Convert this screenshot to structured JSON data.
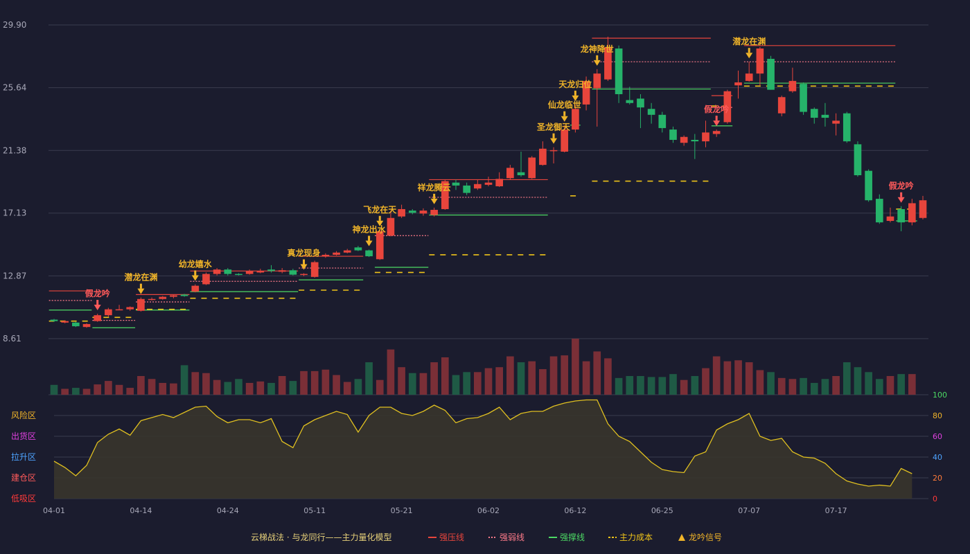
{
  "chart_data": {
    "type": "candlestick",
    "x_tick_labels": [
      "04-01",
      "04-14",
      "04-24",
      "05-11",
      "05-21",
      "06-02",
      "06-12",
      "06-25",
      "07-07",
      "07-17"
    ],
    "x_tick_indices": [
      0,
      8,
      16,
      24,
      32,
      40,
      48,
      56,
      64,
      72
    ],
    "price_axis": {
      "ticks": [
        "29.90",
        "25.64",
        "21.38",
        "17.13",
        "12.87",
        "8.61"
      ],
      "min": 8.61,
      "max": 29.9
    },
    "candles": [
      [
        9.9,
        9.8,
        9.95,
        9.75
      ],
      [
        9.7,
        9.8,
        9.85,
        9.65
      ],
      [
        9.7,
        9.45,
        9.75,
        9.4
      ],
      [
        9.4,
        9.6,
        9.65,
        9.35
      ],
      [
        9.8,
        10.2,
        10.3,
        9.75
      ],
      [
        10.2,
        10.6,
        10.7,
        10.1
      ],
      [
        10.6,
        10.6,
        10.9,
        10.55
      ],
      [
        10.6,
        10.75,
        10.8,
        10.5
      ],
      [
        10.5,
        11.3,
        11.4,
        10.45
      ],
      [
        11.3,
        11.3,
        11.4,
        11.2
      ],
      [
        11.3,
        11.45,
        11.5,
        11.25
      ],
      [
        11.45,
        11.55,
        11.6,
        11.35
      ],
      [
        11.6,
        11.5,
        11.65,
        11.45
      ],
      [
        11.8,
        12.2,
        12.3,
        11.75
      ],
      [
        12.3,
        13.0,
        13.1,
        12.25
      ],
      [
        13.0,
        13.3,
        13.4,
        12.9
      ],
      [
        13.3,
        13.0,
        13.4,
        12.9
      ],
      [
        13.0,
        12.95,
        13.05,
        12.9
      ],
      [
        13.0,
        13.2,
        13.3,
        12.95
      ],
      [
        13.1,
        13.2,
        13.35,
        13.05
      ],
      [
        13.3,
        13.2,
        13.6,
        13.1
      ],
      [
        13.15,
        13.25,
        13.4,
        13.05
      ],
      [
        13.25,
        12.95,
        13.35,
        12.9
      ],
      [
        12.95,
        13.0,
        13.05,
        12.85
      ],
      [
        12.8,
        13.8,
        13.9,
        12.75
      ],
      [
        14.2,
        14.3,
        14.4,
        14.1
      ],
      [
        14.3,
        14.45,
        14.55,
        14.25
      ],
      [
        14.45,
        14.6,
        14.7,
        14.4
      ],
      [
        14.8,
        14.6,
        14.9,
        14.55
      ],
      [
        14.6,
        14.2,
        14.65,
        14.15
      ],
      [
        14.0,
        15.9,
        16.0,
        13.95
      ],
      [
        15.6,
        16.8,
        17.3,
        15.55
      ],
      [
        16.9,
        17.4,
        17.7,
        16.8
      ],
      [
        17.3,
        17.15,
        17.4,
        17.05
      ],
      [
        17.1,
        17.3,
        17.45,
        16.95
      ],
      [
        17.0,
        17.35,
        17.5,
        16.9
      ],
      [
        17.4,
        19.3,
        19.4,
        17.35
      ],
      [
        19.2,
        19.0,
        19.4,
        18.7
      ],
      [
        19.0,
        18.5,
        19.2,
        18.35
      ],
      [
        18.8,
        19.1,
        19.4,
        18.7
      ],
      [
        19.05,
        19.2,
        19.6,
        18.95
      ],
      [
        18.95,
        19.45,
        19.9,
        18.9
      ],
      [
        19.5,
        20.2,
        20.4,
        19.4
      ],
      [
        19.9,
        19.7,
        21.3,
        19.6
      ],
      [
        19.5,
        20.9,
        21.0,
        19.45
      ],
      [
        20.4,
        21.5,
        22.0,
        20.35
      ],
      [
        21.4,
        21.4,
        21.6,
        20.5
      ],
      [
        21.3,
        22.8,
        23.1,
        21.25
      ],
      [
        22.8,
        24.2,
        24.5,
        22.6
      ],
      [
        24.5,
        26.1,
        26.4,
        24.1
      ],
      [
        25.6,
        26.6,
        26.9,
        23.0
      ],
      [
        26.2,
        28.4,
        29.1,
        26.1
      ],
      [
        28.3,
        25.2,
        28.5,
        24.6
      ],
      [
        24.8,
        24.6,
        25.7,
        24.5
      ],
      [
        24.9,
        24.3,
        25.2,
        22.9
      ],
      [
        24.2,
        23.8,
        24.6,
        23.2
      ],
      [
        23.8,
        22.9,
        24.0,
        22.6
      ],
      [
        22.8,
        22.1,
        23.0,
        21.9
      ],
      [
        21.9,
        22.3,
        22.4,
        21.7
      ],
      [
        22.1,
        22.0,
        22.5,
        20.8
      ],
      [
        22.0,
        22.6,
        23.4,
        21.6
      ],
      [
        22.5,
        22.7,
        22.8,
        22.3
      ],
      [
        23.3,
        25.4,
        25.5,
        23.2
      ],
      [
        25.8,
        26.0,
        26.8,
        24.9
      ],
      [
        26.1,
        26.6,
        27.4,
        26.05
      ],
      [
        26.6,
        28.3,
        28.4,
        25.8
      ],
      [
        27.6,
        25.5,
        27.8,
        25.5
      ],
      [
        23.9,
        25.0,
        25.1,
        23.7
      ],
      [
        25.4,
        26.1,
        27.0,
        25.3
      ],
      [
        25.9,
        24.0,
        26.0,
        23.8
      ],
      [
        24.2,
        23.6,
        24.3,
        23.2
      ],
      [
        23.8,
        23.6,
        24.6,
        23.0
      ],
      [
        23.2,
        23.4,
        23.9,
        22.4
      ],
      [
        23.9,
        22.0,
        24.0,
        21.9
      ],
      [
        21.8,
        19.7,
        22.0,
        19.6
      ],
      [
        20.0,
        18.0,
        20.1,
        17.9
      ],
      [
        18.1,
        16.5,
        18.4,
        16.4
      ],
      [
        16.6,
        16.9,
        17.5,
        16.5
      ],
      [
        17.4,
        16.5,
        17.6,
        15.9
      ],
      [
        16.5,
        17.8,
        18.1,
        16.3
      ],
      [
        16.8,
        18.0,
        18.3,
        16.7
      ]
    ],
    "volume": [
      1,
      0.6,
      0.7,
      0.6,
      1.05,
      1.4,
      1.0,
      0.7,
      1.9,
      1.6,
      1.2,
      1.15,
      3.0,
      2.3,
      2.2,
      1.5,
      1.3,
      1.6,
      1.2,
      1.35,
      1.2,
      1.9,
      1.4,
      2.4,
      2.4,
      2.55,
      2.0,
      1.3,
      1.6,
      3.3,
      1.5,
      4.6,
      2.8,
      2.2,
      2.2,
      3.3,
      3.8,
      2.0,
      2.3,
      2.3,
      2.7,
      2.8,
      3.9,
      3.3,
      3.4,
      2.6,
      3.9,
      4.0,
      5.7,
      3.4,
      4.4,
      3.7,
      1.7,
      1.9,
      1.9,
      1.8,
      1.8,
      2.1,
      1.5,
      1.9,
      2.7,
      3.9,
      3.4,
      3.5,
      3.3,
      2.5,
      2.3,
      1.7,
      1.6,
      1.7,
      1.2,
      1.6,
      1.9,
      3.3,
      2.8,
      2.3,
      1.6,
      1.9,
      2.1,
      2.1
    ],
    "volume_max": 5.7,
    "oscillator": {
      "axis_ticks": [
        "100",
        "80",
        "60",
        "40",
        "20",
        "0"
      ],
      "zones": [
        "风险区",
        "出货区",
        "拉升区",
        "建仓区",
        "低吸区"
      ],
      "values": [
        36,
        30,
        22,
        32,
        54,
        62,
        67,
        61,
        75,
        78,
        81,
        78,
        83,
        88,
        89,
        79,
        73,
        76,
        76,
        73,
        77,
        55,
        49,
        70,
        76,
        80,
        84,
        81,
        64,
        80,
        88,
        88,
        82,
        80,
        84,
        90,
        85,
        73,
        77,
        78,
        82,
        88,
        76,
        82,
        84,
        84,
        89,
        92,
        94,
        95,
        95,
        72,
        60,
        55,
        45,
        35,
        28,
        26,
        25,
        41,
        45,
        66,
        72,
        76,
        82,
        60,
        56,
        58,
        45,
        40,
        39,
        34,
        24,
        17,
        14,
        12,
        13,
        12,
        29,
        24
      ]
    },
    "signals": [
      {
        "index": 4,
        "label": "假龙吟",
        "type": "fake"
      },
      {
        "index": 8,
        "label": "潜龙在渊",
        "type": "real"
      },
      {
        "index": 13,
        "label": "幼龙嬉水",
        "type": "real"
      },
      {
        "index": 23,
        "label": "真龙现身",
        "type": "real"
      },
      {
        "index": 29,
        "label": "神龙出水",
        "type": "real"
      },
      {
        "index": 30,
        "label": "飞龙在天",
        "type": "real"
      },
      {
        "index": 35,
        "label": "祥龙腾云",
        "type": "real"
      },
      {
        "index": 46,
        "label": "圣龙御天",
        "type": "real"
      },
      {
        "index": 47,
        "label": "仙龙临世",
        "type": "real"
      },
      {
        "index": 48,
        "label": "天龙归位",
        "type": "real"
      },
      {
        "index": 50,
        "label": "龙神降世",
        "type": "real"
      },
      {
        "index": 61,
        "label": "假龙吟",
        "type": "fake"
      },
      {
        "index": 64,
        "label": "潜龙在渊",
        "type": "real"
      },
      {
        "index": 78,
        "label": "假龙吟",
        "type": "fake"
      }
    ],
    "levels": [
      {
        "kind": "strong_resist",
        "from": 0,
        "to": 3,
        "price": 11.85
      },
      {
        "kind": "weak",
        "from": 0,
        "to": 3,
        "price": 11.2
      },
      {
        "kind": "strong_support",
        "from": 0,
        "to": 3,
        "price": 10.55
      },
      {
        "kind": "cost",
        "from": 0,
        "to": 3,
        "price": 9.8
      },
      {
        "kind": "weak",
        "from": 4,
        "to": 7,
        "price": 9.85
      },
      {
        "kind": "strong_support",
        "from": 4,
        "to": 7,
        "price": 9.35
      },
      {
        "kind": "cost",
        "from": 4,
        "to": 7,
        "price": 10.05
      },
      {
        "kind": "strong_resist",
        "from": 8,
        "to": 12,
        "price": 11.6
      },
      {
        "kind": "weak",
        "from": 8,
        "to": 12,
        "price": 11.1
      },
      {
        "kind": "strong_support",
        "from": 8,
        "to": 12,
        "price": 10.55
      },
      {
        "kind": "cost",
        "from": 8,
        "to": 12,
        "price": 10.6
      },
      {
        "kind": "strong_resist",
        "from": 13,
        "to": 22,
        "price": 13.2
      },
      {
        "kind": "weak",
        "from": 13,
        "to": 22,
        "price": 12.5
      },
      {
        "kind": "strong_support",
        "from": 13,
        "to": 22,
        "price": 11.8
      },
      {
        "kind": "cost",
        "from": 13,
        "to": 22,
        "price": 11.35
      },
      {
        "kind": "strong_resist",
        "from": 23,
        "to": 28,
        "price": 14.2
      },
      {
        "kind": "weak",
        "from": 23,
        "to": 28,
        "price": 13.4
      },
      {
        "kind": "strong_support",
        "from": 23,
        "to": 28,
        "price": 12.6
      },
      {
        "kind": "cost",
        "from": 23,
        "to": 28,
        "price": 11.9
      },
      {
        "kind": "weak",
        "from": 30,
        "to": 34,
        "price": 15.6
      },
      {
        "kind": "strong_support",
        "from": 30,
        "to": 34,
        "price": 13.45
      },
      {
        "kind": "cost",
        "from": 30,
        "to": 34,
        "price": 13.1
      },
      {
        "kind": "strong_resist",
        "from": 35,
        "to": 45,
        "price": 19.4
      },
      {
        "kind": "weak",
        "from": 35,
        "to": 45,
        "price": 18.2
      },
      {
        "kind": "strong_support",
        "from": 35,
        "to": 45,
        "price": 17.0
      },
      {
        "kind": "cost",
        "from": 35,
        "to": 45,
        "price": 14.3
      },
      {
        "kind": "strong_support",
        "from": 48,
        "to": 48,
        "price": 23.1
      },
      {
        "kind": "cost",
        "from": 48,
        "to": 48,
        "price": 18.3
      },
      {
        "kind": "strong_resist",
        "from": 50,
        "to": 60,
        "price": 29.0
      },
      {
        "kind": "weak",
        "from": 50,
        "to": 60,
        "price": 27.4
      },
      {
        "kind": "strong_support",
        "from": 50,
        "to": 60,
        "price": 25.55
      },
      {
        "kind": "cost",
        "from": 50,
        "to": 60,
        "price": 19.3
      },
      {
        "kind": "strong_resist",
        "from": 61,
        "to": 62,
        "price": 25.1
      },
      {
        "kind": "weak",
        "from": 61,
        "to": 62,
        "price": 24.3
      },
      {
        "kind": "strong_support",
        "from": 61,
        "to": 62,
        "price": 23.05
      },
      {
        "kind": "cost",
        "from": 61,
        "to": 62,
        "price": 24.4
      },
      {
        "kind": "strong_resist",
        "from": 64,
        "to": 77,
        "price": 28.5
      },
      {
        "kind": "weak",
        "from": 64,
        "to": 77,
        "price": 27.4
      },
      {
        "kind": "strong_support",
        "from": 64,
        "to": 77,
        "price": 25.95
      },
      {
        "kind": "cost",
        "from": 64,
        "to": 77,
        "price": 25.75
      },
      {
        "kind": "strong_support",
        "from": 78,
        "to": 79,
        "price": 16.6
      },
      {
        "kind": "cost",
        "from": 78,
        "to": 79,
        "price": 17.4
      }
    ],
    "legend": {
      "title": "云梯战法 · 与龙同行——主力量化模型",
      "items": [
        {
          "label": "强压线",
          "kind": "strong_resist"
        },
        {
          "label": "强弱线",
          "kind": "weak"
        },
        {
          "label": "强撑线",
          "kind": "strong_support"
        },
        {
          "label": "主力成本",
          "kind": "cost"
        },
        {
          "label": "龙吟信号",
          "kind": "signal"
        }
      ]
    },
    "colors": {
      "background": "#1b1c2e",
      "grid": "#3a3b4f",
      "up": "#e8453c",
      "down": "#26b36a",
      "vol_up": "#7a2f37",
      "vol_down": "#1f5a45",
      "signal_real": "#f0b429",
      "signal_fake": "#ff5a5a",
      "strong_resist": "#e8453c",
      "weak": "#ff7b8a",
      "strong_support": "#4cd964",
      "cost": "#f0c419",
      "osc_line": "#e0c020",
      "osc_fill": "#39352c",
      "axis_text": "#a8a8b8",
      "zone_risk": "#f0b429",
      "zone_sell": "#e040e0",
      "zone_lift": "#4da3ff",
      "zone_build": "#ff5a5a",
      "zone_low": "#ff3a3a",
      "osc_tick_100": "#4cd964",
      "osc_tick_80": "#f0b429",
      "osc_tick_60": "#e040e0",
      "osc_tick_40": "#4da3ff",
      "osc_tick_20": "#ff7b3a",
      "osc_tick_0": "#ff3a3a"
    }
  }
}
